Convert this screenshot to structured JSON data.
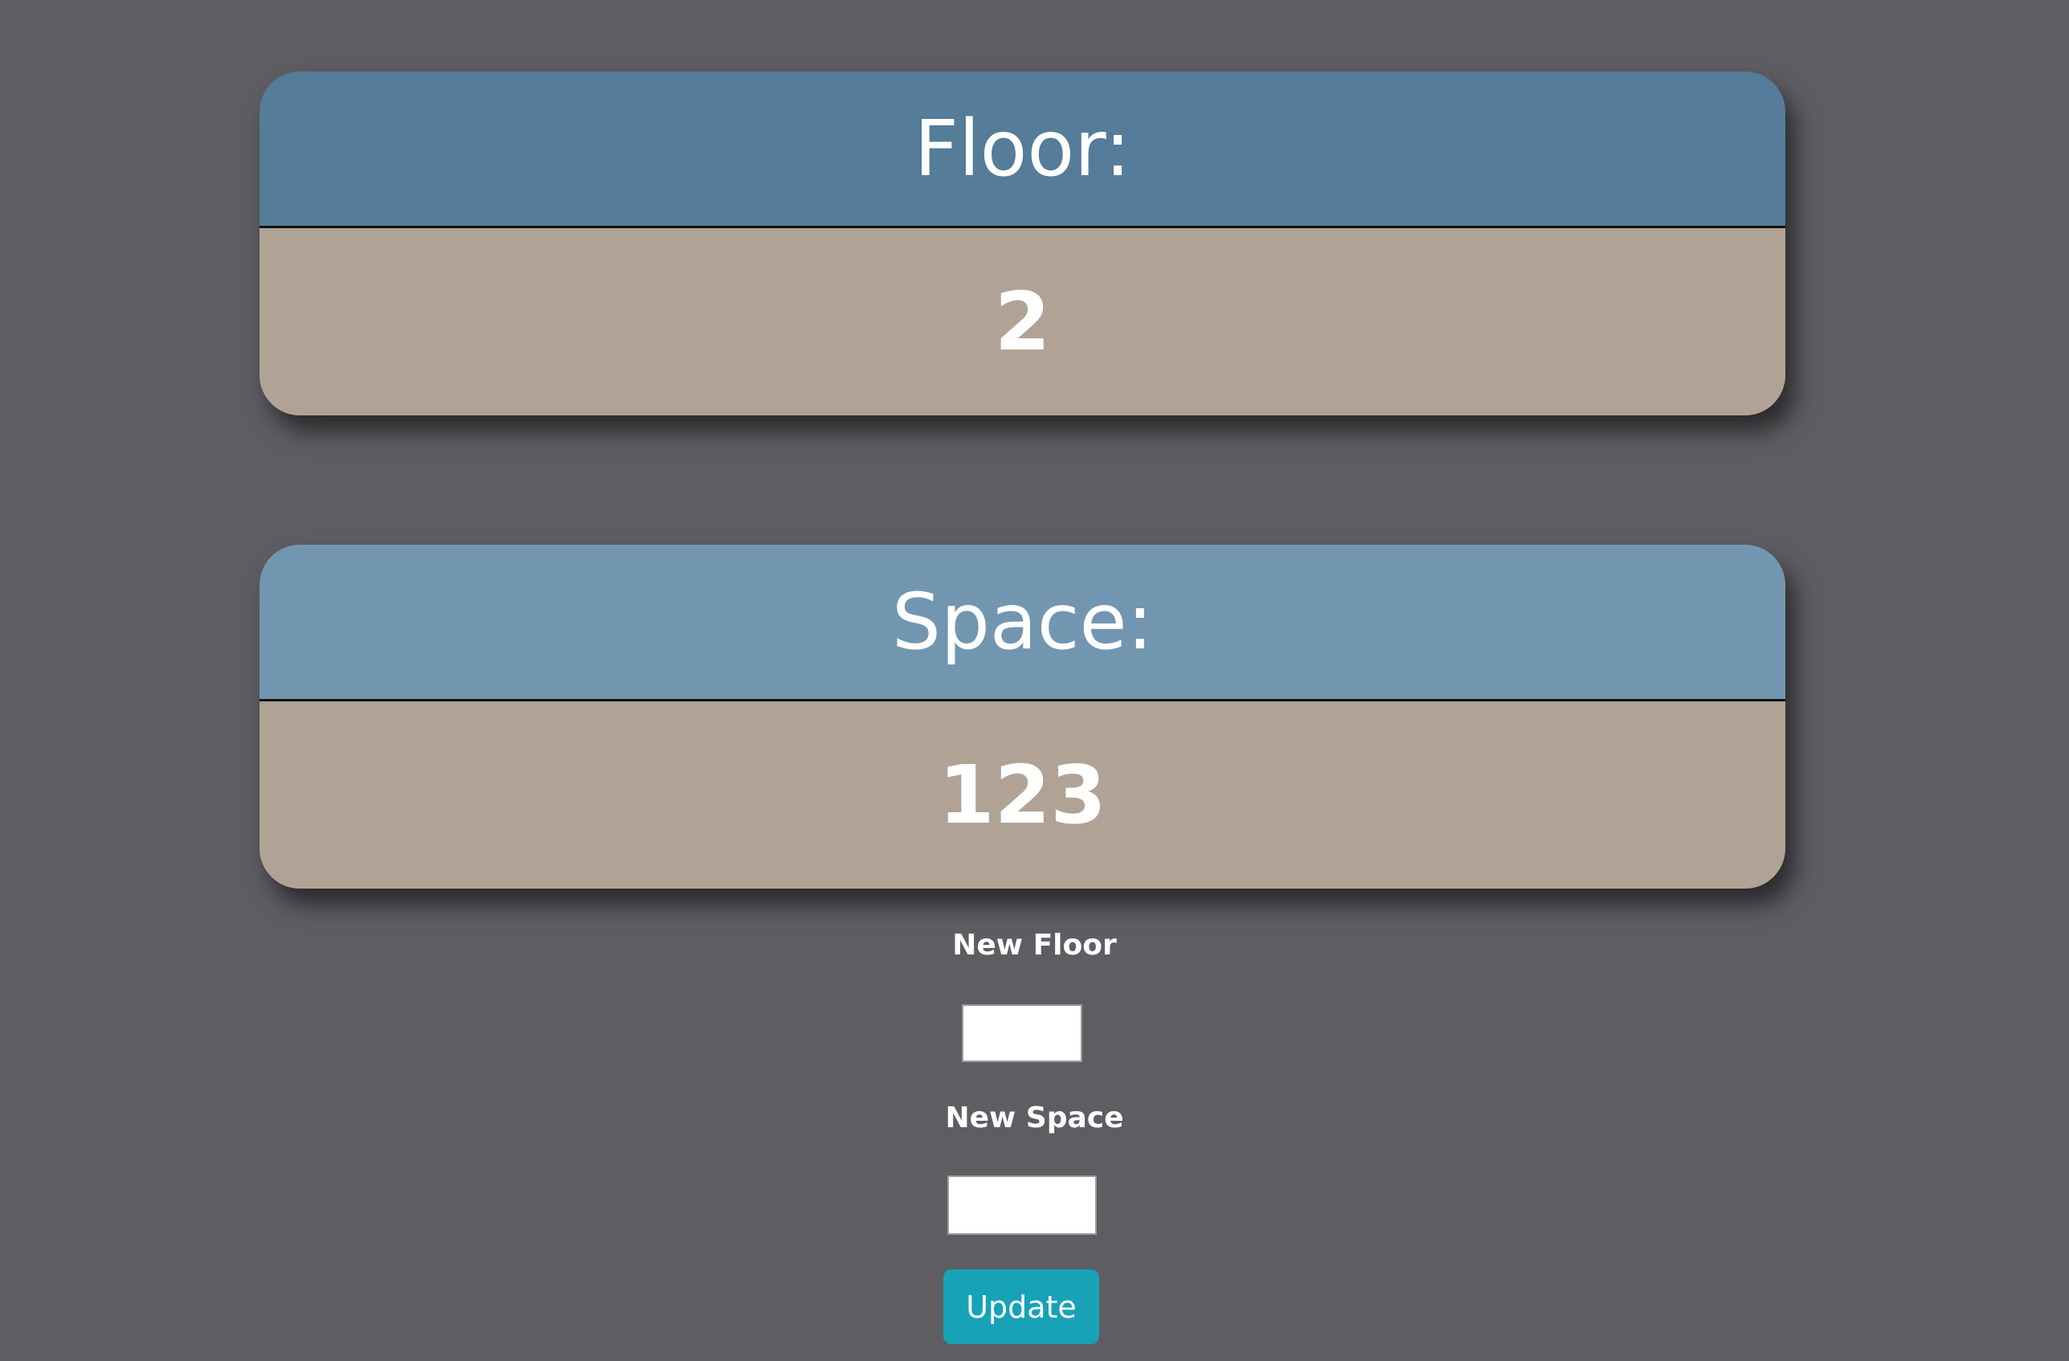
{
  "floor_card": {
    "title": "Floor:",
    "value": "2"
  },
  "space_card": {
    "title": "Space:",
    "value": "123"
  },
  "form": {
    "new_floor_label": "New Floor",
    "new_floor_value": "",
    "new_space_label": "New Space",
    "new_space_value": "",
    "update_label": "Update"
  },
  "colors": {
    "background": "#5e5d62",
    "floor_header": "#557c98",
    "space_header": "#7396b0",
    "card_body": "#b0a396",
    "button": "#17a2b8"
  }
}
